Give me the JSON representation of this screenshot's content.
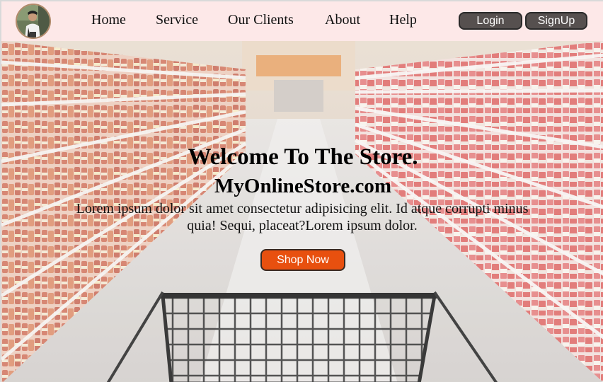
{
  "nav": {
    "avatar_alt": "profile photo",
    "links": [
      "Home",
      "Service",
      "Our Clients",
      "About",
      "Help"
    ],
    "login_label": "Login",
    "signup_label": "SignUp"
  },
  "hero": {
    "background": "grocery-store-aisle-with-shopping-cart",
    "title": "Welcome To The Store.",
    "subtitle": "MyOnlineStore.com",
    "text": "Lorem ipsum dolor sit amet consectetur adipisicing elit. Id atque corrupti minus quia! Sequi, placeat?Lorem ipsum dolor.",
    "cta_label": "Shop Now"
  },
  "colors": {
    "navbar_bg": "#fde8e8",
    "button_dark": "#56504f",
    "cta": "#e8500f"
  }
}
